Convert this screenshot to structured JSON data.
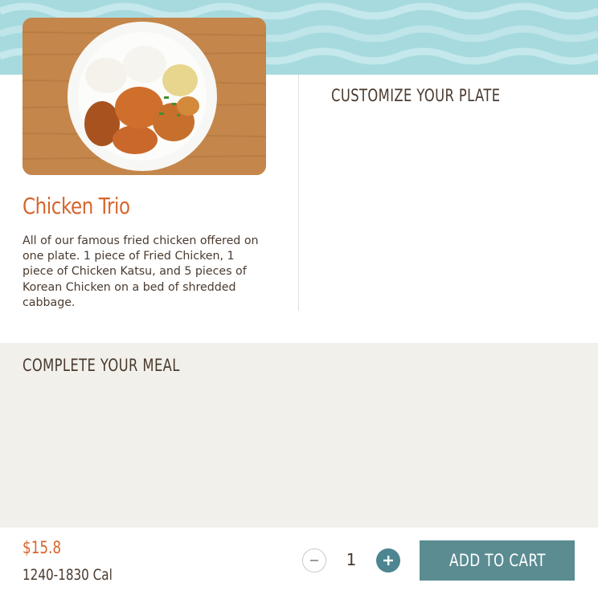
{
  "product": {
    "name": "Chicken Trio",
    "description": "All of our famous fried chicken offered on one plate. 1 piece of Fried Chicken, 1 piece of Chicken Katsu, and 5 pieces of Korean Chicken on a bed of shredded cabbage."
  },
  "sections": {
    "customize_heading": "CUSTOMIZE YOUR PLATE",
    "complete_meal_heading": "COMPLETE YOUR MEAL"
  },
  "footer": {
    "price": "$15.8",
    "calories": "1240-1830 Cal",
    "quantity": "1",
    "add_to_cart_label": "ADD TO CART"
  },
  "icons": {
    "decrement": "minus-icon",
    "increment": "plus-icon"
  },
  "colors": {
    "accent_orange": "#d7652b",
    "button_teal": "#5a8c92",
    "plus_button": "#4d8590",
    "banner": "#a6dadf",
    "section_bg": "#f2f0eb",
    "text": "#4a3a2e"
  }
}
